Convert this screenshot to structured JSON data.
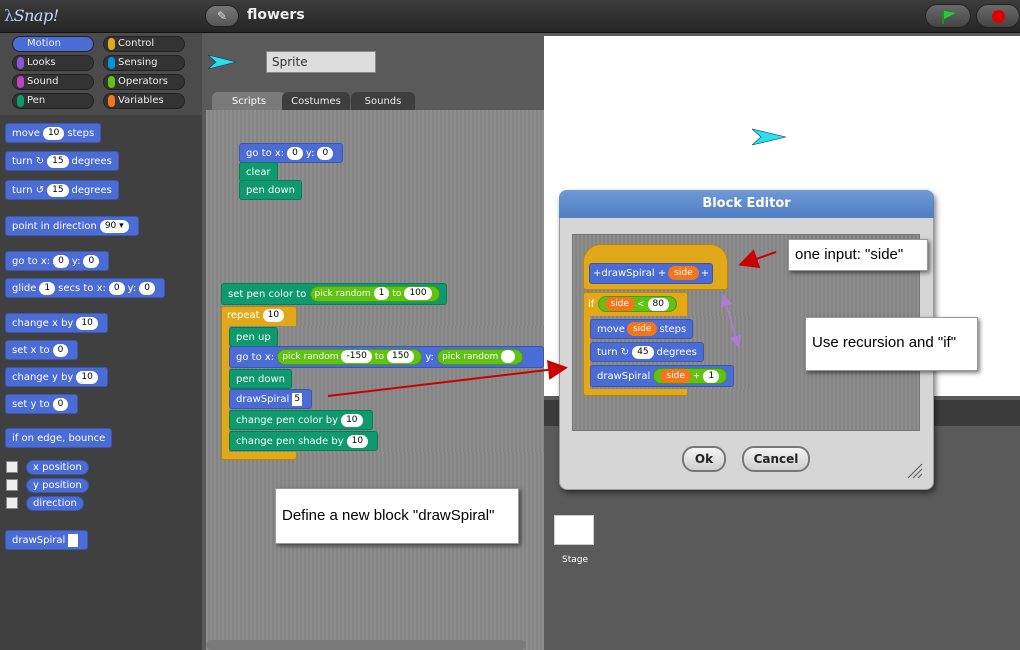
{
  "app": {
    "logo": "Snap!",
    "project_title": "flowers",
    "edit_icon": "pencil-icon",
    "flag_icon": "green-flag-icon",
    "stop_icon": "red-stop-icon"
  },
  "categories": [
    {
      "label": "Motion",
      "color": "#4a6cd4",
      "selected": true
    },
    {
      "label": "Control",
      "color": "#e1a91a"
    },
    {
      "label": "Looks",
      "color": "#8a55d7"
    },
    {
      "label": "Sensing",
      "color": "#0494dc"
    },
    {
      "label": "Sound",
      "color": "#bb42c3"
    },
    {
      "label": "Operators",
      "color": "#62c213"
    },
    {
      "label": "Pen",
      "color": "#0e9a6c"
    },
    {
      "label": "Variables",
      "color": "#f3761d"
    }
  ],
  "palette": {
    "move": {
      "pre": "move",
      "val": "10",
      "post": "steps"
    },
    "turn_cw": {
      "pre": "turn ↻",
      "val": "15",
      "post": "degrees"
    },
    "turn_ccw": {
      "pre": "turn ↺",
      "val": "15",
      "post": "degrees"
    },
    "point": {
      "pre": "point in direction",
      "val": "90"
    },
    "goto": {
      "pre": "go to x:",
      "x": "0",
      "mid": "y:",
      "y": "0"
    },
    "glide": {
      "pre": "glide",
      "secs": "1",
      "mid1": "secs to x:",
      "x": "0",
      "mid2": "y:",
      "y": "0"
    },
    "change_x": {
      "pre": "change x by",
      "val": "10"
    },
    "set_x": {
      "pre": "set x to",
      "val": "0"
    },
    "change_y": {
      "pre": "change y by",
      "val": "10"
    },
    "set_y": {
      "pre": "set y to",
      "val": "0"
    },
    "bounce": "if on edge, bounce",
    "reporters": [
      "x position",
      "y position",
      "direction"
    ],
    "custom_block": "drawSpiral"
  },
  "sprite": {
    "name": "Sprite",
    "tabs": [
      "Scripts",
      "Costumes",
      "Sounds"
    ],
    "active_tab": "Scripts"
  },
  "scripts": {
    "script1": {
      "goto": {
        "pre": "go to x:",
        "x": "0",
        "mid": "y:",
        "y": "0"
      },
      "clear": "clear",
      "pen_down": "pen down"
    },
    "script2": {
      "set_pen": {
        "pre": "set pen color to",
        "pick": "pick random",
        "a": "1",
        "to": "to",
        "b": "100"
      },
      "repeat": {
        "pre": "repeat",
        "val": "10"
      },
      "pen_up": "pen up",
      "goto": {
        "pre": "go to x:",
        "pick": "pick random",
        "a": "-150",
        "to": "to",
        "b": "150",
        "mid": "y:",
        "pick2": "pick random"
      },
      "pen_down": "pen down",
      "draw": {
        "pre": "drawSpiral",
        "val": "5"
      },
      "change_color": {
        "pre": "change pen color by",
        "val": "10"
      },
      "change_shade": {
        "pre": "change pen shade by",
        "val": "10"
      }
    }
  },
  "stage": {
    "thumb_label": "Stage"
  },
  "editor": {
    "title": "Block Editor",
    "hat": {
      "plus1": "+",
      "name": "drawSpiral",
      "plus2": "+",
      "param": "side",
      "plus3": "+"
    },
    "if": {
      "pre": "if",
      "var": "side",
      "op": "<",
      "val": "80"
    },
    "move": {
      "pre": "move",
      "var": "side",
      "post": "steps"
    },
    "turn": {
      "pre": "turn ↻",
      "val": "45",
      "post": "degrees"
    },
    "recurse": {
      "pre": "drawSpiral",
      "var": "side",
      "op": "+",
      "val": "1"
    },
    "ok": "Ok",
    "cancel": "Cancel"
  },
  "callouts": {
    "define": "Define a new block \"drawSpiral\"",
    "input": "one input: \"side\"",
    "recursion": "Use recursion and \"if\""
  }
}
